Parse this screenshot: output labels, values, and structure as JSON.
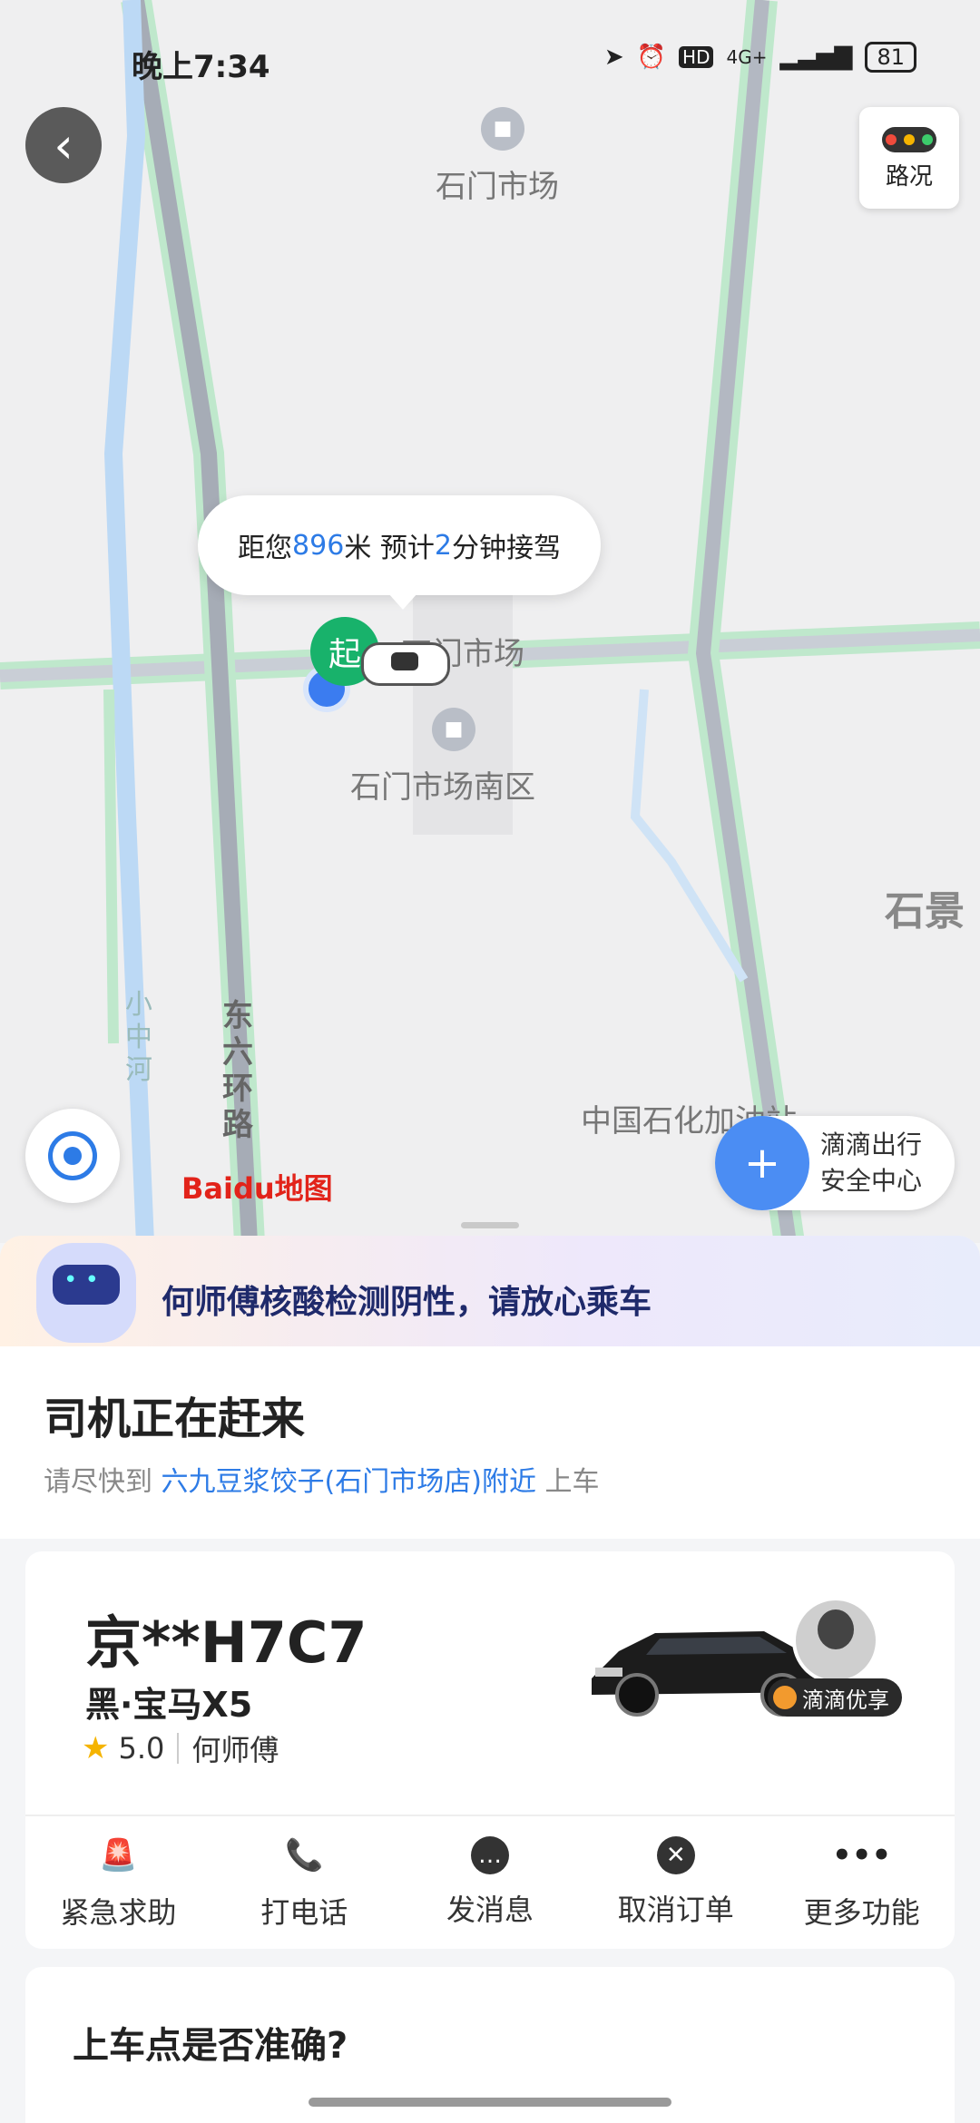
{
  "status_bar": {
    "time": "晚上7:34",
    "network": "4G+",
    "battery": "81",
    "hd": "HD"
  },
  "map": {
    "traffic_label": "路况",
    "poi": {
      "market_top": "石门市场",
      "market_mid": "石门市场",
      "market_south": "石门市场南区",
      "shijing": "石景",
      "gas_station": "中国石化加油站",
      "road_east_six": "东六环路",
      "river": "小中河"
    },
    "eta": {
      "prefix": "距您",
      "distance": "896",
      "unit": "米 预计",
      "minutes": "2",
      "suffix": "分钟接驾"
    },
    "start_pin": "起",
    "baidu_logo": "Baidu地图",
    "safety": {
      "line1": "滴滴出行",
      "line2": "安全中心"
    }
  },
  "banner": {
    "text": "何师傅核酸检测阴性，请放心乘车"
  },
  "trip_status": {
    "title": "司机正在赶来",
    "sub_prefix": "请尽快到",
    "location": "六九豆浆饺子(石门市场店)附近",
    "sub_suffix": "上车"
  },
  "driver": {
    "plate": "京**H7C7",
    "car": "黑·宝马X5",
    "rating": "5.0",
    "name": "何师傅",
    "badge": "滴滴优享"
  },
  "actions": [
    {
      "label": "紧急求助",
      "icon": "alarm-icon"
    },
    {
      "label": "打电话",
      "icon": "phone-icon"
    },
    {
      "label": "发消息",
      "icon": "message-icon"
    },
    {
      "label": "取消订单",
      "icon": "cancel-icon"
    },
    {
      "label": "更多功能",
      "icon": "more-icon"
    }
  ],
  "accuracy_question": "上车点是否准确?",
  "colors": {
    "accent": "#2d7be6",
    "start_green": "#18b26b",
    "road_green": "#9fe0b4"
  }
}
